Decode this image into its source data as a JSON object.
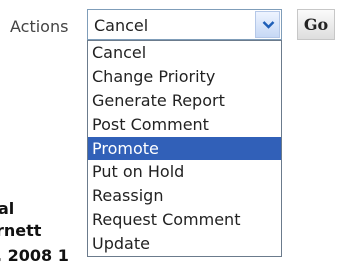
{
  "form": {
    "actions_label": "Actions",
    "selected_value": "Cancel",
    "go_label": "Go"
  },
  "dropdown": {
    "highlighted": "Promote",
    "options": [
      "Cancel",
      "Change Priority",
      "Generate Report",
      "Post Comment",
      "Promote",
      "Put on Hold",
      "Reassign",
      "Request Comment",
      "Update"
    ]
  },
  "background": {
    "line_1": "al",
    "line_2": "rnett",
    "line_3": ", 2008 1"
  },
  "colors": {
    "highlight": "#3160b8",
    "select_border": "#7f9db9",
    "arrow_button": "#c6d8f5"
  },
  "icons": {
    "dropdown_arrow": "chevron-down-icon"
  }
}
